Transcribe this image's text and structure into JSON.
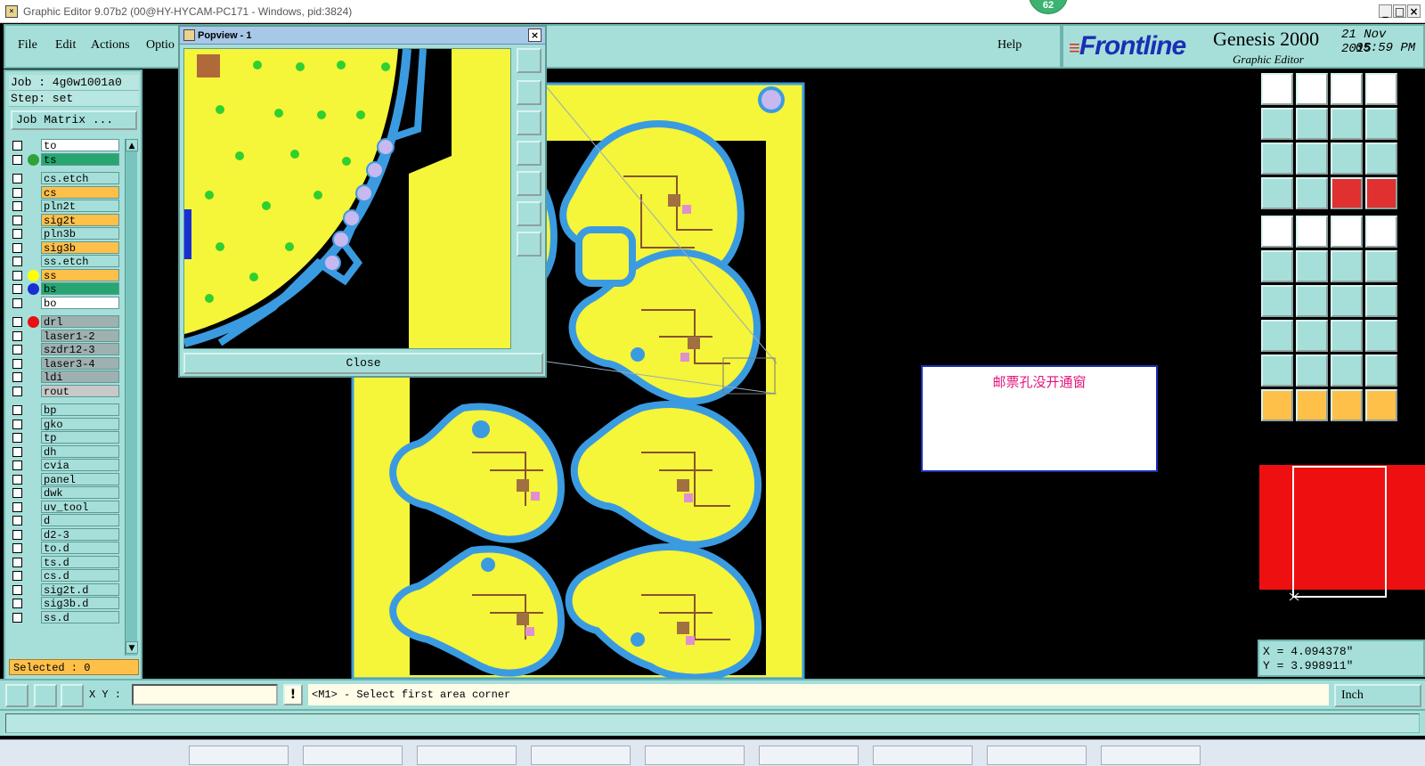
{
  "window": {
    "title": "Graphic Editor 9.07b2 (00@HY-HYCAM-PC171 - Windows, pid:3824)",
    "badge": "62",
    "min_glyph": "_",
    "max_glyph": "□",
    "close_glyph": "×"
  },
  "menu": {
    "items": [
      "File",
      "Edit",
      "Actions",
      "Optio"
    ],
    "help": "Help"
  },
  "brand": {
    "logo": "Frontline",
    "product": "Genesis 2000",
    "subtitle": "Graphic Editor",
    "date": "21 Nov 2015",
    "time": "05:59 PM"
  },
  "job": {
    "job_line": "Job : 4g0w1001a0",
    "step_line": "Step: set",
    "job_matrix": "Job Matrix ..."
  },
  "layers": [
    {
      "name": "to",
      "bg": "#ffffff",
      "dot": ""
    },
    {
      "name": "ts",
      "bg": "#27a672",
      "dot": "#2fa33a"
    },
    {
      "name": "cs.etch",
      "bg": "#a6dfd9",
      "dot": ""
    },
    {
      "name": "cs",
      "bg": "#ffc04a",
      "dot": ""
    },
    {
      "name": "pln2t",
      "bg": "#a6dfd9",
      "dot": ""
    },
    {
      "name": "sig2t",
      "bg": "#ffc04a",
      "dot": ""
    },
    {
      "name": "pln3b",
      "bg": "#a6dfd9",
      "dot": ""
    },
    {
      "name": "sig3b",
      "bg": "#ffc04a",
      "dot": ""
    },
    {
      "name": "ss.etch",
      "bg": "#a6dfd9",
      "dot": ""
    },
    {
      "name": "ss",
      "bg": "#ffc04a",
      "dot": "#ffff00"
    },
    {
      "name": "bs",
      "bg": "#27a672",
      "dot": "#1a2fd0"
    },
    {
      "name": "bo",
      "bg": "#ffffff",
      "dot": ""
    },
    {
      "name": "drl",
      "bg": "#9fb0b0",
      "dot": "#e81010"
    },
    {
      "name": "laser1-2",
      "bg": "#9fb0b0",
      "dot": ""
    },
    {
      "name": "szdr12-3",
      "bg": "#9fb0b0",
      "dot": ""
    },
    {
      "name": "laser3-4",
      "bg": "#9fb0b0",
      "dot": ""
    },
    {
      "name": "ldi",
      "bg": "#9fb0b0",
      "dot": ""
    },
    {
      "name": "rout",
      "bg": "#c8c8c8",
      "dot": ""
    },
    {
      "name": "bp",
      "bg": "#a6dfd9",
      "dot": ""
    },
    {
      "name": "gko",
      "bg": "#a6dfd9",
      "dot": ""
    },
    {
      "name": "tp",
      "bg": "#a6dfd9",
      "dot": ""
    },
    {
      "name": "dh",
      "bg": "#a6dfd9",
      "dot": ""
    },
    {
      "name": "cvia",
      "bg": "#a6dfd9",
      "dot": ""
    },
    {
      "name": "panel",
      "bg": "#a6dfd9",
      "dot": ""
    },
    {
      "name": "dwk",
      "bg": "#a6dfd9",
      "dot": ""
    },
    {
      "name": "uv_tool",
      "bg": "#a6dfd9",
      "dot": ""
    },
    {
      "name": "d",
      "bg": "#a6dfd9",
      "dot": ""
    },
    {
      "name": "d2-3",
      "bg": "#a6dfd9",
      "dot": ""
    },
    {
      "name": "to.d",
      "bg": "#a6dfd9",
      "dot": ""
    },
    {
      "name": "ts.d",
      "bg": "#a6dfd9",
      "dot": ""
    },
    {
      "name": "cs.d",
      "bg": "#a6dfd9",
      "dot": ""
    },
    {
      "name": "sig2t.d",
      "bg": "#a6dfd9",
      "dot": ""
    },
    {
      "name": "sig3b.d",
      "bg": "#a6dfd9",
      "dot": ""
    },
    {
      "name": "ss.d",
      "bg": "#a6dfd9",
      "dot": ""
    }
  ],
  "selected": "Selected : 0",
  "popview": {
    "title": "Popview - 1",
    "close_button": "Close"
  },
  "note_text": "邮票孔没开通窗",
  "coords": {
    "x": "X = 4.094378\"",
    "y": "Y = 3.998911\""
  },
  "bottom": {
    "xy_label": "X Y :",
    "xy_value": "",
    "bang": "!",
    "prompt": "<M1> - Select first area corner",
    "units": "Inch"
  },
  "colors": {
    "panel": "#a6dfd9",
    "board_fill": "#f5f53a",
    "outline": "#3b9be0",
    "accent_orange": "#ffc04a"
  }
}
